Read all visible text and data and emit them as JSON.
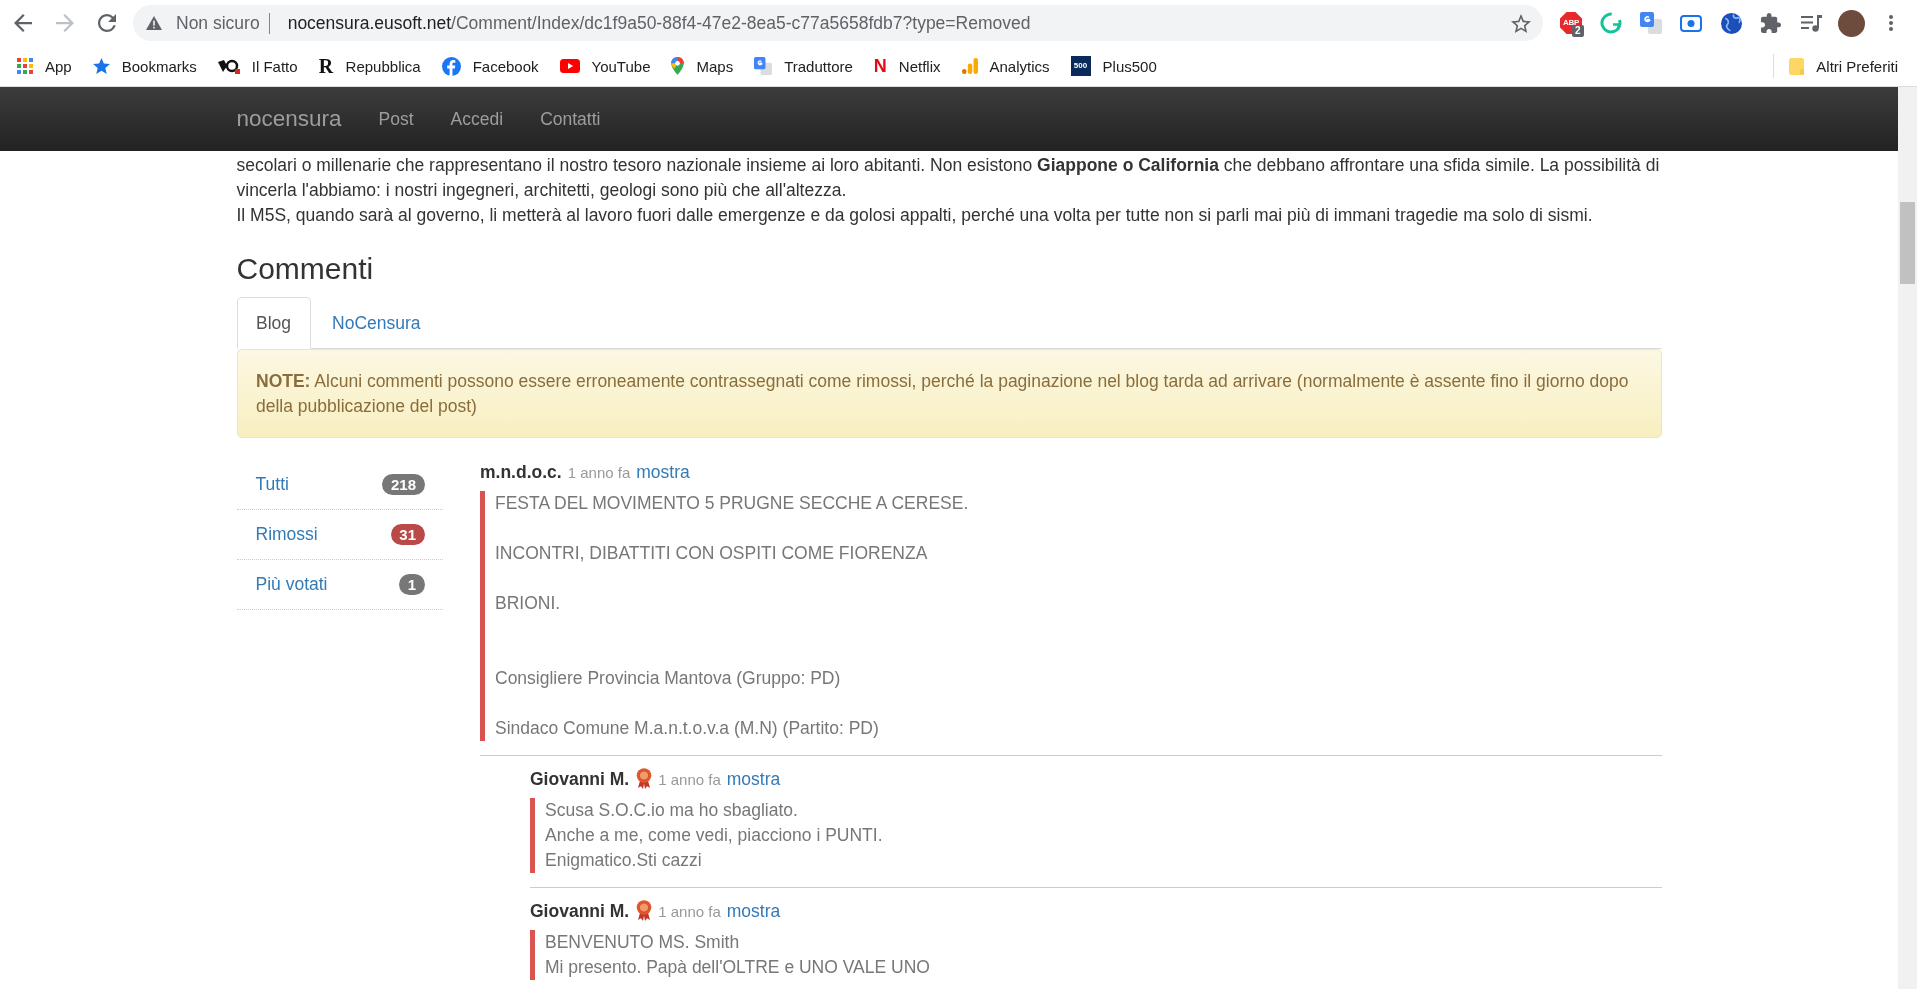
{
  "browser": {
    "nav_buttons": [
      {
        "kind": "back",
        "disabled": false
      },
      {
        "kind": "forward",
        "disabled": true
      },
      {
        "kind": "reload",
        "disabled": false
      }
    ],
    "address_bar": {
      "security_label": "Non sicuro",
      "host": "nocensura.eusoft.net",
      "path": "/Comment/Index/dc1f9a50-88f4-47e2-8ea5-c77a5658fdb7?type=Removed"
    },
    "extensions": [
      {
        "kind": "adblock",
        "label": "ABP",
        "badge": "2"
      },
      {
        "kind": "ring"
      },
      {
        "kind": "translate"
      },
      {
        "kind": "record"
      },
      {
        "kind": "globe"
      },
      {
        "kind": "puzzle"
      },
      {
        "kind": "media"
      }
    ],
    "bookmarks": [
      {
        "kind": "apps",
        "label": "App"
      },
      {
        "kind": "star",
        "label": "Bookmarks"
      },
      {
        "kind": "mark",
        "label": "Il Fatto"
      },
      {
        "kind": "serif_letter",
        "icon_text": "R",
        "label": "Repubblica"
      },
      {
        "kind": "circle",
        "label": "Facebook"
      },
      {
        "kind": "play",
        "label": "YouTube"
      },
      {
        "kind": "pin",
        "label": "Maps"
      },
      {
        "kind": "translate",
        "label": "Traduttore"
      },
      {
        "kind": "red_letter",
        "icon_text": "N",
        "label": "Netflix"
      },
      {
        "kind": "bars",
        "label": "Analytics"
      },
      {
        "kind": "tile",
        "icon_text": "500",
        "label": "Plus500"
      }
    ],
    "other_bookmarks": {
      "label": "Altri Preferiti"
    }
  },
  "navbar": {
    "brand": "nocensura",
    "links": [
      "Post",
      "Accedi",
      "Contatti"
    ]
  },
  "article": {
    "paragraphs": [
      "secolari o millenarie che rappresentano il nostro tesoro nazionale insieme ai loro abitanti. Non esistono **Giappone o California** che debbano affrontare una sfida simile. La possibilità di vincerla l'abbiamo: i nostri ingegneri, architetti, geologi sono più che all'altezza.",
      "Il M5S, quando sarà al governo, li metterà al lavoro fuori dalle emergenze e da golosi appalti, perché una volta per tutte non si parli mai più di immani tragedie ma solo di sismi."
    ]
  },
  "comments_heading": "Commenti",
  "tabs": [
    {
      "label": "Blog",
      "selected": true
    },
    {
      "label": "NoCensura",
      "selected": false
    }
  ],
  "note": {
    "text": "**NOTE:** Alcuni commenti possono essere erroneamente contrassegnati come rimossi, perché la paginazione nel blog tarda ad arrivare (normalmente è assente fino il giorno dopo della pubblicazione del post)"
  },
  "filters": [
    {
      "label": "Tutti",
      "count": "218",
      "color": "#777777"
    },
    {
      "label": "Rimossi",
      "count": "31",
      "color": "#b94a48"
    },
    {
      "label": "Più votati",
      "count": "1",
      "color": "#777777"
    }
  ],
  "comments": [
    {
      "author": "m.n.d.o.c.",
      "award": false,
      "time": "1 anno fa",
      "action": "mostra",
      "text": "FESTA DEL MOVIMENTO 5 PRUGNE SECCHE A CERESE.\n\nINCONTRI, DIBATTITI CON OSPITI COME FIORENZA\n\nBRIONI.\n\n\nConsigliere Provincia Mantova (Gruppo: PD)\n\nSindaco Comune M.a.n.t.o.v.a (M.N) (Partito: PD)",
      "children": [
        {
          "author": "Giovanni M.",
          "award": true,
          "time": "1 anno fa",
          "action": "mostra",
          "text": "Scusa S.O.C.io ma ho sbagliato.\nAnche a me, come vedi, piacciono i PUNTI.\nEnigmatico.Sti cazzi"
        },
        {
          "author": "Giovanni M.",
          "award": true,
          "time": "1 anno fa",
          "action": "mostra",
          "text": "BENVENUTO MS. Smith\nMi presento. Papà dell'OLTRE e UNO VALE UNO"
        }
      ]
    }
  ]
}
